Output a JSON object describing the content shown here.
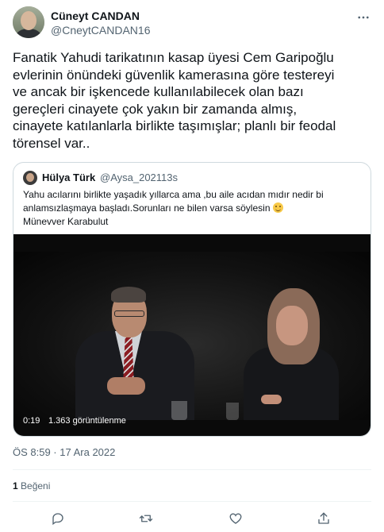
{
  "author": {
    "display_name": "Cüneyt CANDAN",
    "handle": "@CneytCANDAN16"
  },
  "tweet": {
    "text": "Fanatik Yahudi tarikatının kasap üyesi Cem Garipoğlu\nevlerinin önündeki güvenlik kamerasına göre testereyi\nve ancak bir işkencede kullanılabilecek olan bazı\ngereçleri cinayete çok yakın bir zamanda almış,\ncinayete katılanlarla birlikte taşımışlar; planlı bir feodal\ntörensel var..",
    "timestamp": "ÖS 8:59 · 17 Ara 2022",
    "likes_count": "1",
    "likes_label": "Beğeni"
  },
  "quote": {
    "display_name": "Hülya Türk",
    "handle": "@Aysa_2021",
    "separator": "·",
    "time": "13s",
    "text_line1": "Yahu acılarını birlikte yaşadık yıllarca ama ,bu aile acıdan mıdır nedir bi",
    "text_line2": "anlamsızlaşmaya başladı.Sorunları ne bilen varsa söylesin",
    "text_line3": "Münevver Karabulut",
    "video": {
      "elapsed": "0:19",
      "views": "1.363 görüntülenme"
    }
  },
  "icons": {
    "more": "more-horizontal-icon",
    "reply": "reply-icon",
    "retweet": "retweet-icon",
    "like": "heart-icon",
    "share": "share-icon",
    "emoji": "smiling-face-emoji"
  },
  "colors": {
    "text": "#0f1419",
    "secondary": "#536471",
    "border": "#cfd9de"
  }
}
